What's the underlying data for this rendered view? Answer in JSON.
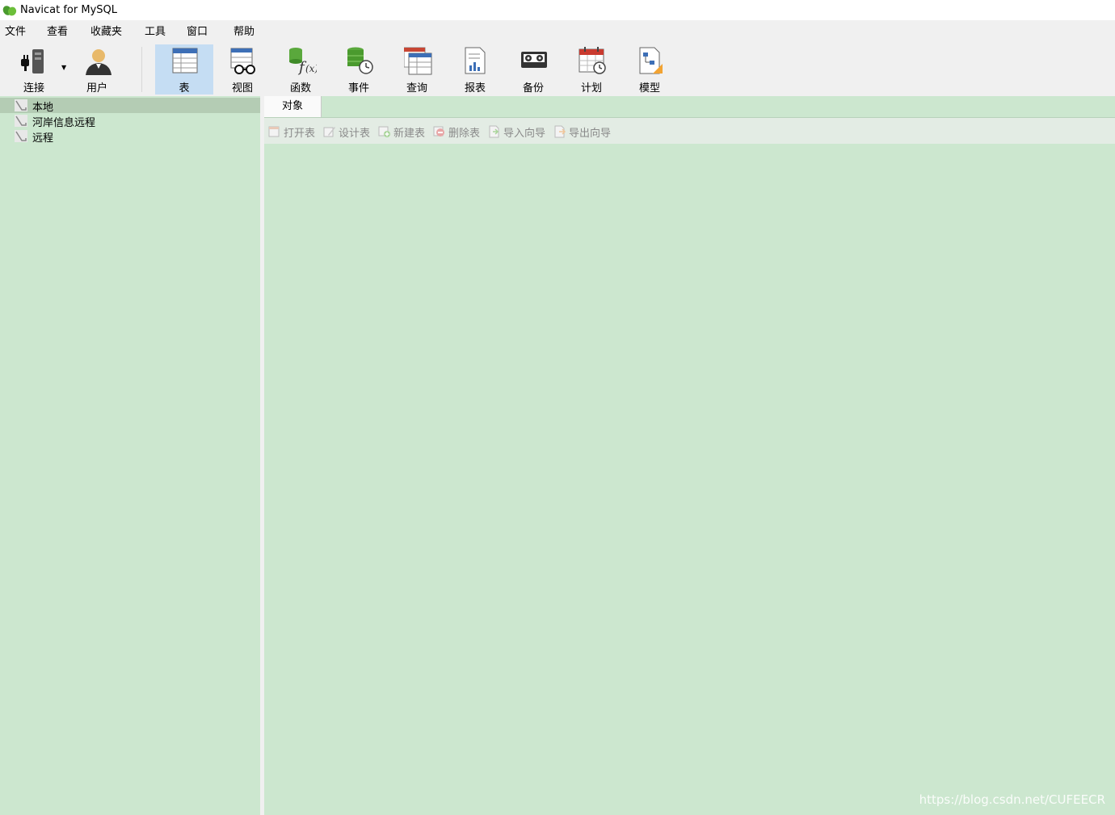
{
  "window": {
    "title": "Navicat for MySQL"
  },
  "menu": {
    "items": [
      "文件",
      "查看",
      "收藏夹",
      "工具",
      "窗口",
      "帮助"
    ]
  },
  "toolbar": {
    "connect": "连接",
    "user": "用户",
    "table": "表",
    "view": "视图",
    "function": "函数",
    "event": "事件",
    "query": "查询",
    "report": "报表",
    "backup": "备份",
    "schedule": "计划",
    "model": "模型"
  },
  "connections": [
    {
      "label": "本地",
      "selected": true
    },
    {
      "label": "河岸信息远程",
      "selected": false
    },
    {
      "label": "远程",
      "selected": false
    }
  ],
  "tabs": [
    "对象"
  ],
  "object_toolbar": {
    "open_table": "打开表",
    "design_table": "设计表",
    "new_table": "新建表",
    "delete_table": "删除表",
    "import_wizard": "导入向导",
    "export_wizard": "导出向导"
  },
  "watermark": "https://blog.csdn.net/CUFEECR",
  "colors": {
    "background": "#cce7cf",
    "selected_row": "#b4ccb4",
    "active_tool": "#c5ddf3",
    "toolbar": "#f0f0f0"
  }
}
